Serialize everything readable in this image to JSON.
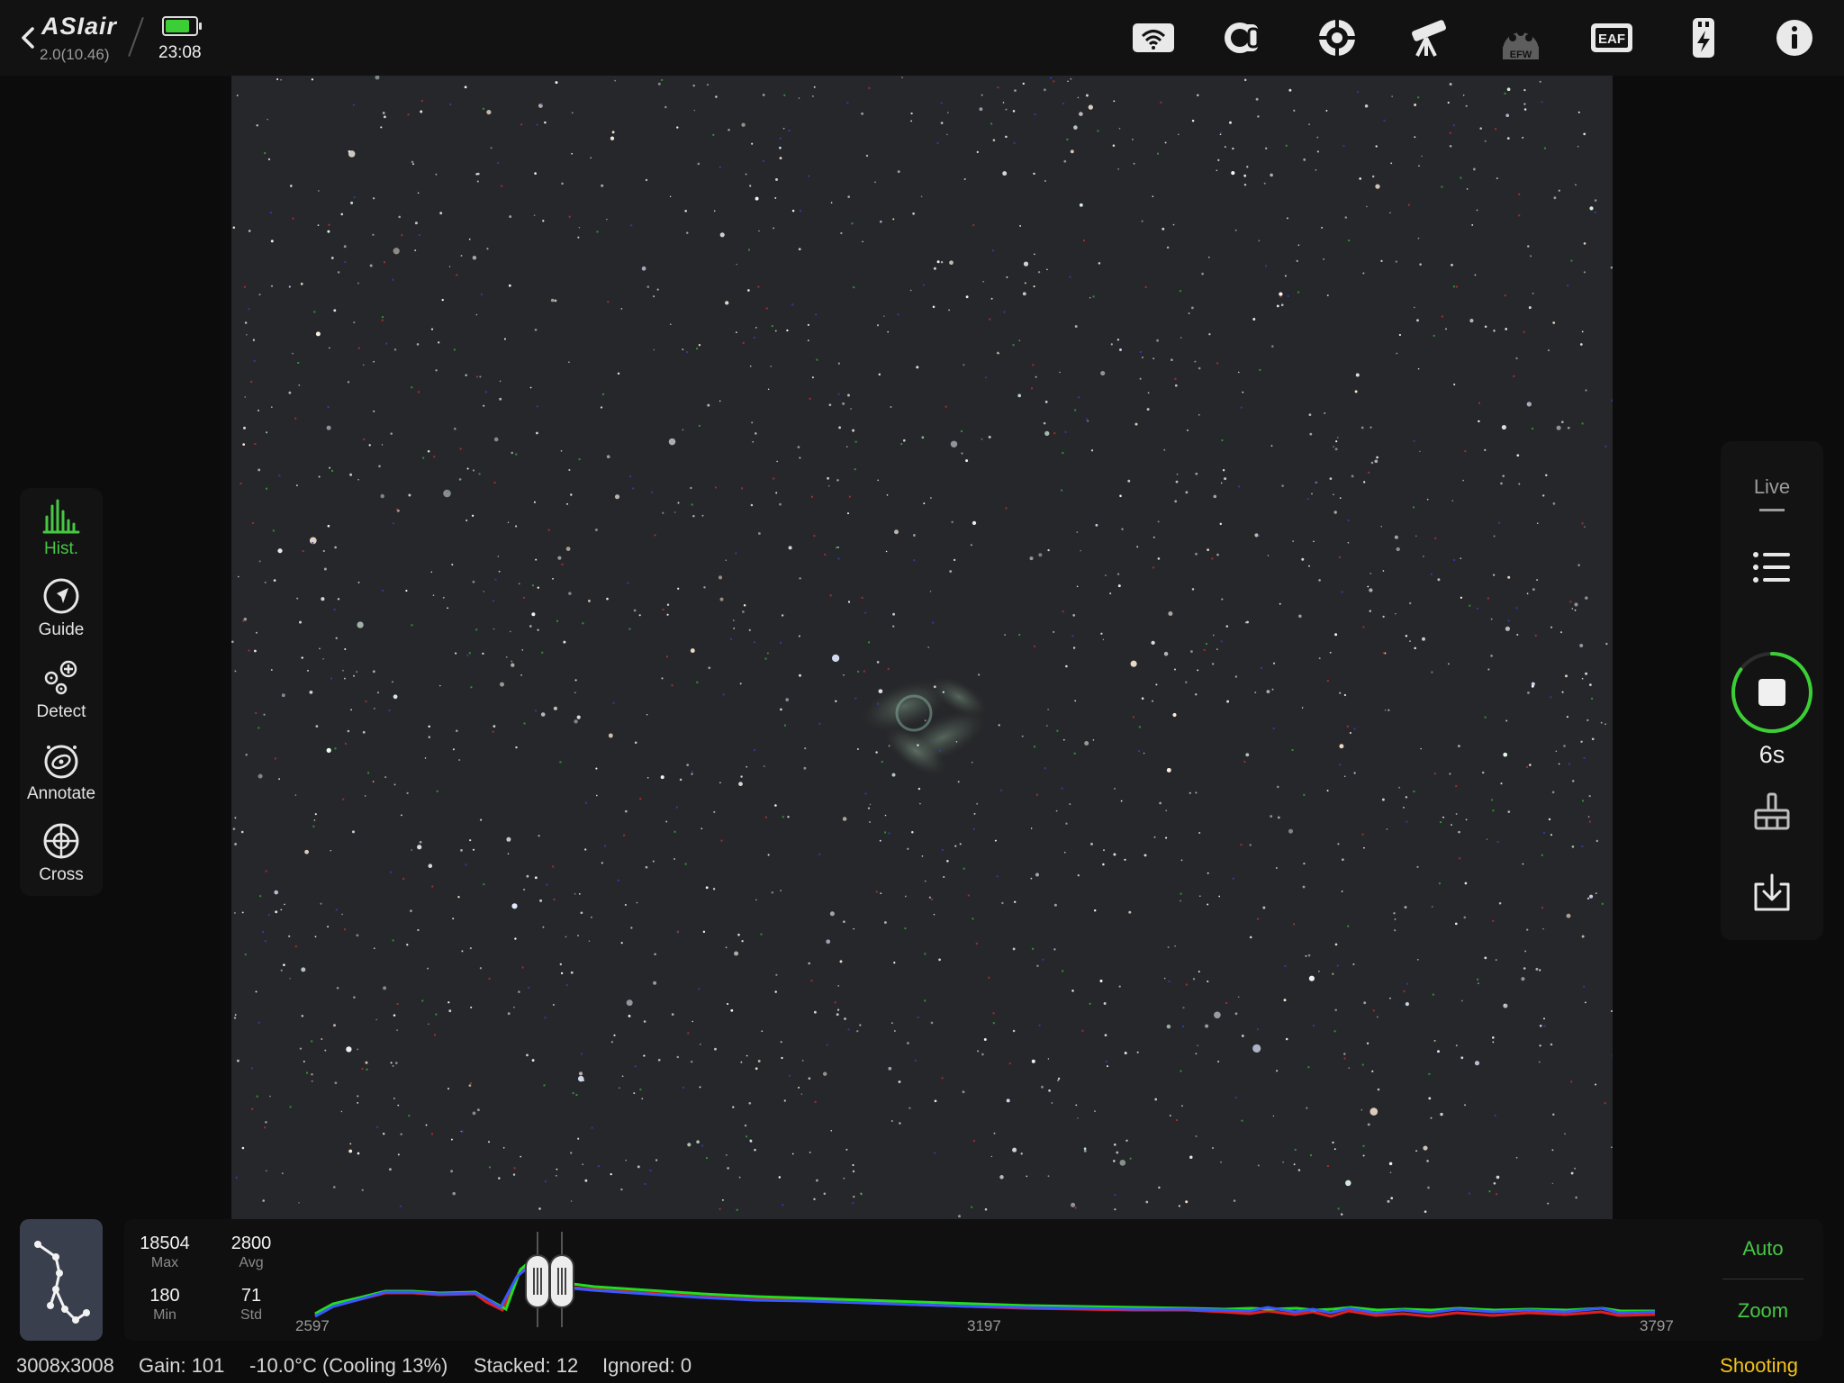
{
  "app": {
    "logo": "ASIair",
    "version": "2.0(10.46)",
    "time": "23:08",
    "battery_level": 0.8
  },
  "top_icons": [
    {
      "name": "wifi-icon",
      "label": ""
    },
    {
      "name": "camera-icon",
      "label": ""
    },
    {
      "name": "guide-scope-icon",
      "label": ""
    },
    {
      "name": "telescope-icon",
      "label": ""
    },
    {
      "name": "efw-icon",
      "label": "EFW"
    },
    {
      "name": "eaf-icon",
      "label": "EAF"
    },
    {
      "name": "power-icon",
      "label": ""
    },
    {
      "name": "info-icon",
      "label": ""
    }
  ],
  "tools": [
    {
      "name": "hist",
      "label": "Hist.",
      "icon": "histogram-icon",
      "active": true
    },
    {
      "name": "guide",
      "label": "Guide",
      "icon": "guide-icon",
      "active": false
    },
    {
      "name": "detect",
      "label": "Detect",
      "icon": "detect-stars-icon",
      "active": false
    },
    {
      "name": "annotate",
      "label": "Annotate",
      "icon": "annotate-galaxy-icon",
      "active": false
    },
    {
      "name": "cross",
      "label": "Cross",
      "icon": "crosshair-icon",
      "active": false
    }
  ],
  "right_panel": {
    "mode": "Live",
    "exposure": "6s",
    "progress": 0.85
  },
  "histogram": {
    "max_value": "18504",
    "max_label": "Max",
    "avg_value": "2800",
    "avg_label": "Avg",
    "min_value": "180",
    "min_label": "Min",
    "std_value": "71",
    "std_label": "Std",
    "axis": [
      "2597",
      "3197",
      "3797"
    ],
    "auto": "Auto",
    "zoom": "Zoom"
  },
  "status": {
    "resolution": "3008x3008",
    "gain": "Gain: 101",
    "temperature": "-10.0°C (Cooling 13%)",
    "stacked": "Stacked: 12",
    "ignored": "Ignored: 0",
    "state": "Shooting"
  },
  "colors": {
    "accent": "#47c744",
    "state": "#f2c21a",
    "hist_red": "#e02020",
    "hist_green": "#1fe01f",
    "hist_blue": "#3a58ff"
  }
}
